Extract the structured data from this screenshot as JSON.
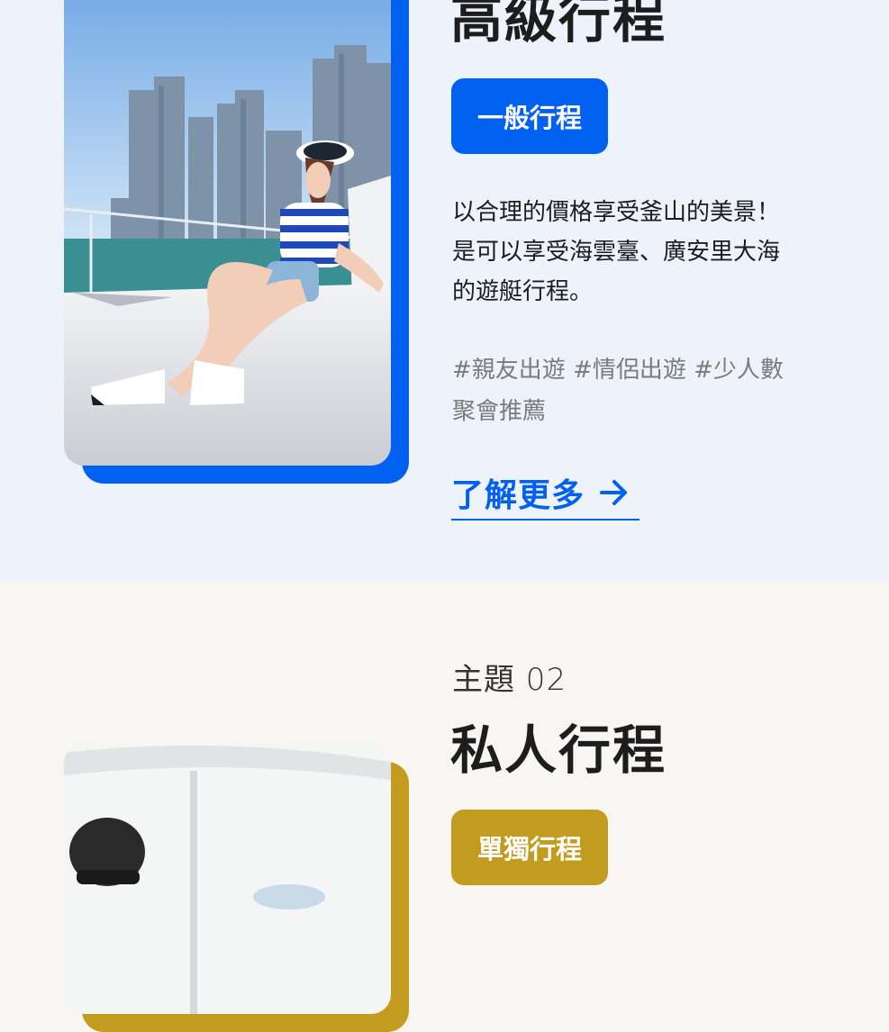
{
  "colors": {
    "primary_blue": "#0061f0",
    "gold": "#c39b1e",
    "section1_bg": "#edf2fb",
    "section2_bg": "#f7f6f3"
  },
  "theme1": {
    "title": "高級行程",
    "badge": "一般行程",
    "description_lines": [
      "以合理的價格享受釜山的美景！",
      "是可以享受海雲臺、廣安里大海",
      "的遊艇行程。"
    ],
    "tags_lines": [
      "#親友出遊 #情侶出遊 #少人數",
      "聚會推薦"
    ],
    "more_link": "了解更多",
    "more_icon": "arrow-right-icon"
  },
  "theme2": {
    "label": "主題 02",
    "title": "私人行程",
    "badge": "單獨行程"
  }
}
